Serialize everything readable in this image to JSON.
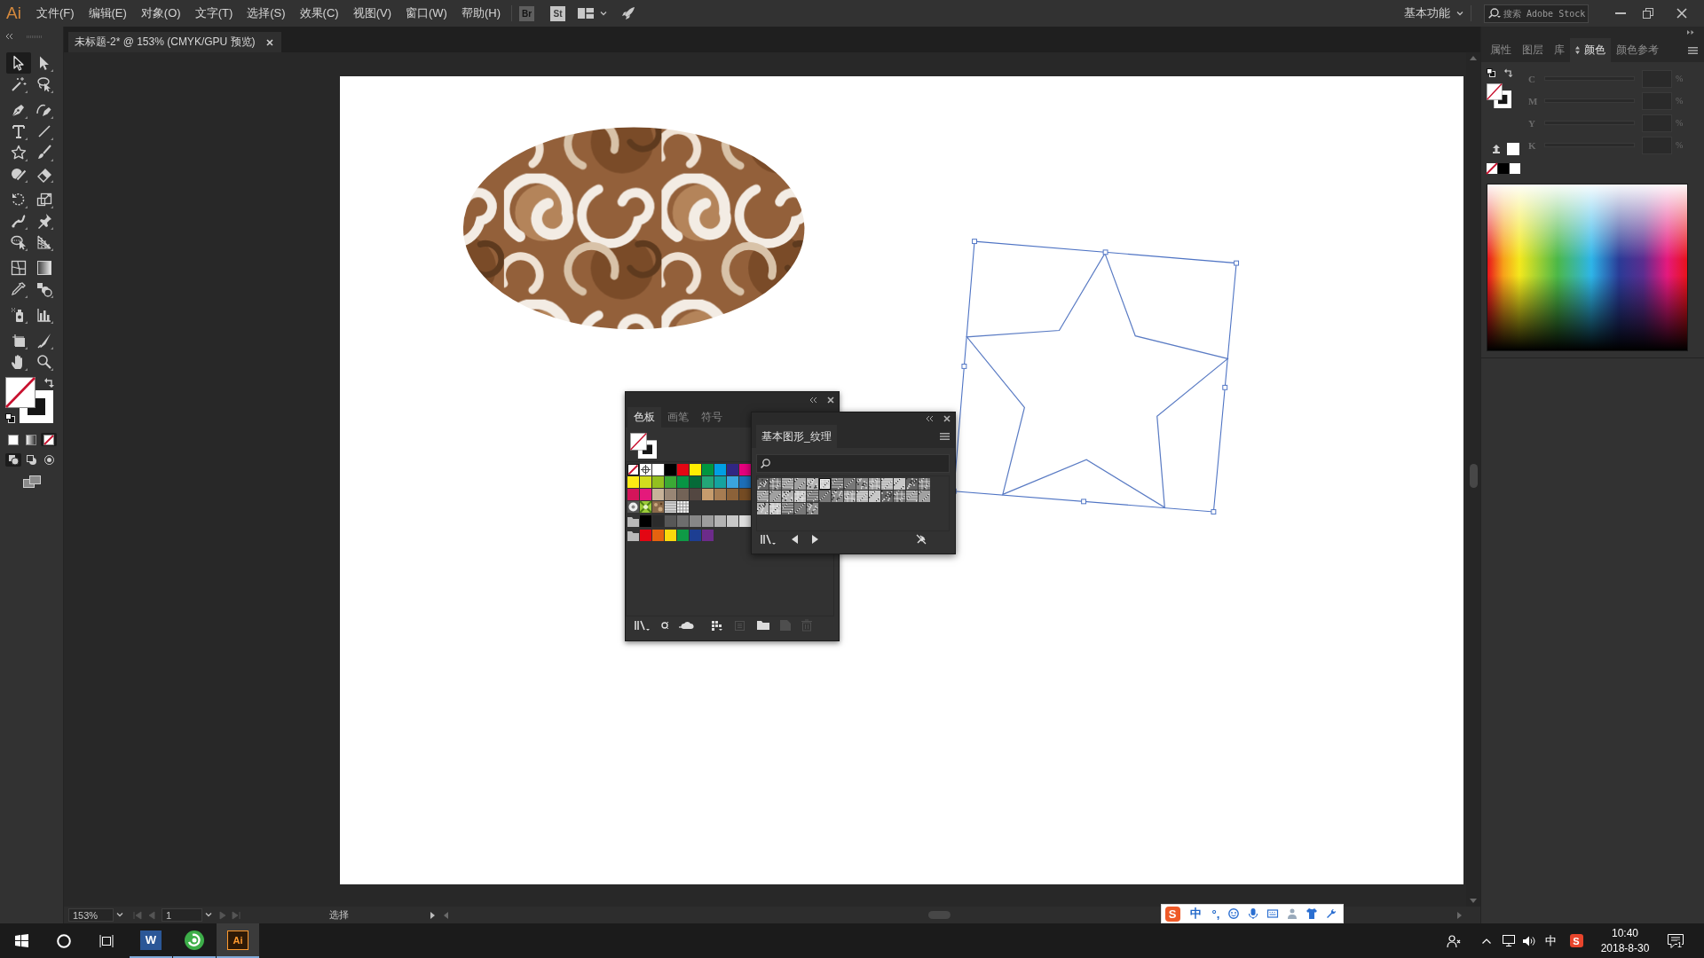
{
  "app_bar": {
    "logo": "Ai",
    "menus": [
      "文件(F)",
      "编辑(E)",
      "对象(O)",
      "文字(T)",
      "选择(S)",
      "效果(C)",
      "视图(V)",
      "窗口(W)",
      "帮助(H)"
    ],
    "bridge": "Br",
    "stock": "St",
    "workspace": "基本功能",
    "search": {
      "placeholder": "搜索 Adobe Stock"
    }
  },
  "document_tabs": [
    {
      "title": "未标题-2* @ 153% (CMYK/GPU 预览)",
      "selected": true
    }
  ],
  "tools": [
    {
      "kind": "select",
      "selected": true
    },
    {
      "kind": "direct",
      "selected": false
    },
    {
      "kind": "wand",
      "selected": false
    },
    {
      "kind": "lasso",
      "selected": false
    },
    {
      "kind": "pen",
      "selected": false
    },
    {
      "kind": "curvature",
      "selected": false
    },
    {
      "kind": "type",
      "selected": false
    },
    {
      "kind": "line",
      "selected": false
    },
    {
      "kind": "star",
      "selected": false
    },
    {
      "kind": "brush",
      "selected": false
    },
    {
      "kind": "shaper",
      "selected": false
    },
    {
      "kind": "eraser",
      "selected": false
    },
    {
      "kind": "rotate",
      "selected": false
    },
    {
      "kind": "scale",
      "selected": false
    },
    {
      "kind": "puppet",
      "selected": false
    },
    {
      "kind": "pin",
      "selected": false
    },
    {
      "kind": "builder",
      "selected": false
    },
    {
      "kind": "perspective",
      "selected": false
    },
    {
      "kind": "mesh",
      "selected": false
    },
    {
      "kind": "gradient",
      "selected": false
    },
    {
      "kind": "eyedropper",
      "selected": false
    },
    {
      "kind": "blend",
      "selected": false
    },
    {
      "kind": "sprayer",
      "selected": false
    },
    {
      "kind": "graph",
      "selected": false
    },
    {
      "kind": "artboard",
      "selected": false
    },
    {
      "kind": "slice",
      "selected": false
    },
    {
      "kind": "hand",
      "selected": false
    },
    {
      "kind": "zoom",
      "selected": false
    }
  ],
  "color_modes": [
    {
      "kind": "color",
      "selected": false
    },
    {
      "kind": "gradient",
      "selected": false
    },
    {
      "kind": "none",
      "selected": true
    }
  ],
  "draw_modes": [
    {
      "kind": "normal",
      "selected": true
    },
    {
      "kind": "behind",
      "selected": false
    },
    {
      "kind": "inside",
      "selected": false
    }
  ],
  "canvas": {
    "objects": [
      {
        "kind": "ellipse",
        "selected": false
      },
      {
        "kind": "star",
        "selected": true
      }
    ]
  },
  "color_panel": {
    "tabs": [
      {
        "label": "属性",
        "selected": false
      },
      {
        "label": "图层",
        "selected": false
      },
      {
        "label": "库",
        "selected": false
      },
      {
        "label": "颜色",
        "selected": true
      },
      {
        "label": "颜色参考",
        "selected": false
      }
    ],
    "channels": [
      {
        "name": "C",
        "unit": "%",
        "disabled": true
      },
      {
        "name": "M",
        "unit": "%",
        "disabled": true
      },
      {
        "name": "Y",
        "unit": "%",
        "disabled": true
      },
      {
        "name": "K",
        "unit": "%",
        "disabled": true
      }
    ],
    "quick_swatches": [
      {
        "kind": "none"
      },
      {
        "kind": "color",
        "color": "#000000"
      },
      {
        "kind": "color",
        "color": "#ffffff"
      }
    ]
  },
  "swatches_panel": {
    "tabs": [
      {
        "label": "色板",
        "selected": true
      },
      {
        "label": "画笔",
        "selected": false
      },
      {
        "label": "符号",
        "selected": false
      }
    ],
    "rows": [
      [
        {
          "kind": "none"
        },
        {
          "kind": "registration"
        },
        {
          "kind": "color",
          "color": "#ffffff"
        },
        {
          "kind": "color",
          "color": "#000000"
        },
        {
          "kind": "color",
          "color": "#e30613"
        },
        {
          "kind": "color",
          "color": "#ffed00"
        },
        {
          "kind": "color",
          "color": "#009640"
        },
        {
          "kind": "color",
          "color": "#009fe3"
        },
        {
          "kind": "color",
          "color": "#312783"
        },
        {
          "kind": "color",
          "color": "#e6007e"
        }
      ],
      [
        {
          "kind": "color",
          "color": "#fdea14"
        },
        {
          "kind": "color",
          "color": "#d2dc1e"
        },
        {
          "kind": "color",
          "color": "#93c01f"
        },
        {
          "kind": "color",
          "color": "#3ba935"
        },
        {
          "kind": "color",
          "color": "#079544"
        },
        {
          "kind": "color",
          "color": "#056a38"
        },
        {
          "kind": "color",
          "color": "#23a677"
        },
        {
          "kind": "color",
          "color": "#14a39f"
        },
        {
          "kind": "color",
          "color": "#3aa5de"
        },
        {
          "kind": "color",
          "color": "#1d6fb7"
        }
      ],
      [
        {
          "kind": "color",
          "color": "#d4145a"
        },
        {
          "kind": "color",
          "color": "#e4197b"
        },
        {
          "kind": "color",
          "color": "#c7b299"
        },
        {
          "kind": "color",
          "color": "#998675"
        },
        {
          "kind": "color",
          "color": "#736357"
        },
        {
          "kind": "color",
          "color": "#534741"
        },
        {
          "kind": "color",
          "color": "#c69c6d"
        },
        {
          "kind": "color",
          "color": "#a67c52"
        },
        {
          "kind": "color",
          "color": "#8c6239"
        },
        {
          "kind": "color",
          "color": "#754c24"
        }
      ],
      [
        {
          "kind": "pattern"
        },
        {
          "kind": "pattern"
        },
        {
          "kind": "pattern"
        },
        {
          "kind": "pattern"
        },
        {
          "kind": "pattern"
        }
      ],
      [
        {
          "kind": "folder"
        },
        {
          "kind": "color",
          "color": "#000000"
        },
        {
          "kind": "color",
          "color": "#2b2b2b"
        },
        {
          "kind": "color",
          "color": "#575757"
        },
        {
          "kind": "color",
          "color": "#6d6d6d"
        },
        {
          "kind": "color",
          "color": "#878787"
        },
        {
          "kind": "color",
          "color": "#9d9d9d"
        },
        {
          "kind": "color",
          "color": "#b3b3b3"
        },
        {
          "kind": "color",
          "color": "#c8c8c8"
        },
        {
          "kind": "color",
          "color": "#dedede"
        }
      ],
      [
        {
          "kind": "folder"
        },
        {
          "kind": "color",
          "color": "#e30613"
        },
        {
          "kind": "color",
          "color": "#e6620f"
        },
        {
          "kind": "color",
          "color": "#fcd90d"
        },
        {
          "kind": "color",
          "color": "#0f9a46"
        },
        {
          "kind": "color",
          "color": "#1d3e92"
        },
        {
          "kind": "color",
          "color": "#6c2b8a"
        }
      ]
    ],
    "actions": [
      {
        "kind": "library",
        "disabled": false
      },
      {
        "kind": "kinds",
        "disabled": false
      },
      {
        "kind": "cloud",
        "disabled": false
      },
      {
        "kind": "options",
        "disabled": false
      },
      {
        "kind": "group",
        "disabled": true
      },
      {
        "kind": "folder",
        "disabled": false
      },
      {
        "kind": "new",
        "disabled": true
      },
      {
        "kind": "delete",
        "disabled": true
      }
    ]
  },
  "texture_panel": {
    "title": "基本图形_纹理",
    "textures": [
      {
        "selected": false
      },
      {
        "selected": false
      },
      {
        "selected": false
      },
      {
        "selected": false
      },
      {
        "selected": false
      },
      {
        "selected": true
      },
      {
        "selected": false
      },
      {
        "selected": false
      },
      {
        "selected": false
      },
      {
        "selected": false
      },
      {
        "selected": false
      },
      {
        "selected": false
      },
      {
        "selected": false
      },
      {
        "selected": false
      },
      {
        "selected": false
      },
      {
        "selected": false
      },
      {
        "selected": false
      },
      {
        "selected": false
      },
      {
        "selected": false
      },
      {
        "selected": false
      },
      {
        "selected": false
      },
      {
        "selected": false
      },
      {
        "selected": false
      },
      {
        "selected": false
      },
      {
        "selected": false
      },
      {
        "selected": false
      },
      {
        "selected": false
      },
      {
        "selected": false
      },
      {
        "selected": false
      },
      {
        "selected": false
      },
      {
        "selected": false
      },
      {
        "selected": false
      },
      {
        "selected": false
      }
    ]
  },
  "status_bar": {
    "zoom": "153%",
    "artboard": "1",
    "nav": [
      {
        "kind": "first",
        "disabled": true
      },
      {
        "kind": "previous",
        "disabled": true
      },
      {
        "kind": "next",
        "disabled": true
      },
      {
        "kind": "last",
        "disabled": true
      }
    ],
    "tool": "选择"
  },
  "ime_bar": {
    "logo": "S",
    "mode": "中",
    "punctuation": "°,"
  },
  "taskbar": {
    "apps": [
      {
        "kind": "word",
        "label": "W",
        "selected": false
      },
      {
        "kind": "browser",
        "selected": false
      },
      {
        "kind": "illustrator",
        "label": "Ai",
        "selected": true
      }
    ],
    "tray": {
      "ime_logo": "S",
      "input_mode": "中",
      "time": "10:40",
      "date": "2018-8-30",
      "notifications": "1"
    }
  }
}
